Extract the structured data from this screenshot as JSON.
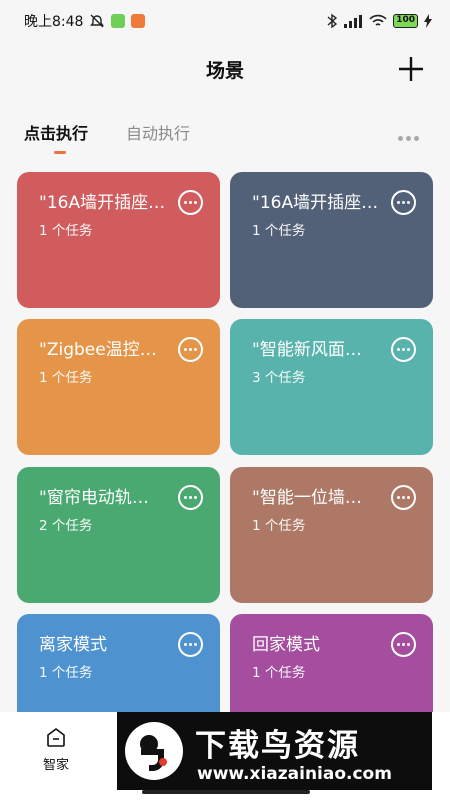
{
  "status_bar": {
    "time": "晚上8:48",
    "battery": "100"
  },
  "header": {
    "title": "场景"
  },
  "tabs": [
    {
      "label": "点击执行",
      "active": true
    },
    {
      "label": "自动执行",
      "active": false
    }
  ],
  "scenes": [
    {
      "name": "\"16A墙开插座…",
      "count": "1 个任务",
      "color": "#d05c5e"
    },
    {
      "name": "\"16A墙开插座…",
      "count": "1 个任务",
      "color": "#536178"
    },
    {
      "name": "\"Zigbee温控…",
      "count": "1 个任务",
      "color": "#e4954a"
    },
    {
      "name": "\"智能新风面…",
      "count": "3 个任务",
      "color": "#58b3ad"
    },
    {
      "name": "\"窗帘电动轨…",
      "count": "2 个任务",
      "color": "#4aa871"
    },
    {
      "name": "\"智能一位墙…",
      "count": "1 个任务",
      "color": "#ad7966"
    },
    {
      "name": "离家模式",
      "count": "1 个任务",
      "color": "#4e92d0"
    },
    {
      "name": "回家模式",
      "count": "1 个任务",
      "color": "#a54d9e"
    }
  ],
  "bottom_nav": {
    "home_label": "智家"
  },
  "watermark": {
    "title": "下载鸟资源",
    "url": "www.xiazainiao.com"
  },
  "colors": {
    "accent": "#f2703a",
    "background": "#f6f6f6"
  }
}
